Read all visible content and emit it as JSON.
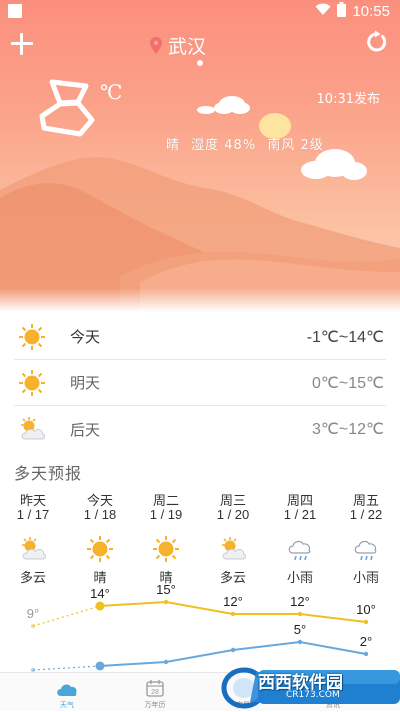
{
  "status_bar": {
    "time": "10:55",
    "icons": [
      "wifi-icon",
      "battery-icon"
    ]
  },
  "header": {
    "city": "武汉",
    "add_icon": "plus-icon",
    "refresh_icon": "refresh-icon",
    "location_icon": "location-pin-icon"
  },
  "current": {
    "temperature": "8",
    "unit": "℃",
    "published": "10:31发布",
    "condition": "晴",
    "humidity": "湿度 48%",
    "wind": "南风 2级"
  },
  "days": [
    {
      "name": "今天",
      "range": "-1℃~14℃",
      "icon": "sunny-icon"
    },
    {
      "name": "明天",
      "range": "0℃~15℃",
      "icon": "sunny-icon"
    },
    {
      "name": "后天",
      "range": "3℃~12℃",
      "icon": "partly-cloudy-icon"
    }
  ],
  "forecast_title": "多天预报",
  "forecast": [
    {
      "weekday": "昨天",
      "date": "1 / 17",
      "cond": "多云",
      "icon": "partly-cloudy-icon",
      "high": "9°",
      "low": ""
    },
    {
      "weekday": "今天",
      "date": "1 / 18",
      "cond": "晴",
      "icon": "sunny-icon",
      "high": "14°",
      "low": ""
    },
    {
      "weekday": "周二",
      "date": "1 / 19",
      "cond": "晴",
      "icon": "sunny-icon",
      "high": "15°",
      "low": ""
    },
    {
      "weekday": "周三",
      "date": "1 / 20",
      "cond": "多云",
      "icon": "partly-cloudy-icon",
      "high": "12°",
      "low": ""
    },
    {
      "weekday": "周四",
      "date": "1 / 21",
      "cond": "小雨",
      "icon": "light-rain-icon",
      "high": "12°",
      "low": "5°"
    },
    {
      "weekday": "周五",
      "date": "1 / 22",
      "cond": "小雨",
      "icon": "light-rain-icon",
      "high": "10°",
      "low": "2°"
    }
  ],
  "chart_data": {
    "type": "line",
    "x": [
      "昨天",
      "今天",
      "周二",
      "周三",
      "周四",
      "周五"
    ],
    "series": [
      {
        "values": [
          9,
          14,
          15,
          12,
          12,
          10
        ],
        "color": "#f0c020"
      },
      {
        "values": [
          -2,
          -1,
          0,
          3,
          5,
          2
        ],
        "color": "#6aa8dc"
      }
    ]
  },
  "tabs": [
    {
      "label": "天气",
      "icon": "weather-cloud-icon",
      "active": true
    },
    {
      "label": "万年历",
      "icon": "calendar-icon",
      "calendar_day": "28",
      "active": false
    },
    {
      "label": "实景",
      "icon": "scenery-icon",
      "active": false
    },
    {
      "label": "资讯",
      "icon": "news-icon",
      "active": false
    }
  ],
  "watermark": {
    "text": "西西软件园",
    "url": "CR173.COM"
  },
  "colors": {
    "hero_top": "#fb8f7d",
    "sun": "#f6b22c",
    "high_line": "#f0c020",
    "low_line": "#6aa8dc",
    "tab_active": "#4aa6d8"
  }
}
